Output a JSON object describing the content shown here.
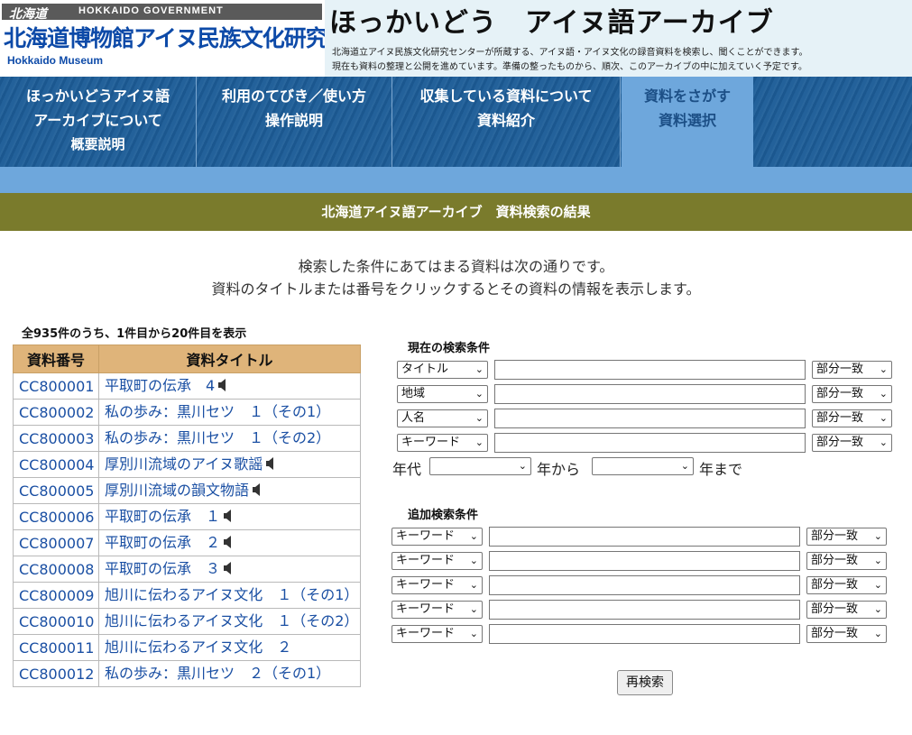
{
  "logo": {
    "script_text": "北海道",
    "gov_text": "HOKKAIDO GOVERNMENT",
    "name": "北海道博物館アイヌ民族文化研究センター",
    "english": "Hokkaido Museum"
  },
  "site": {
    "title": "ほっかいどう　アイヌ語アーカイブ",
    "desc_line1": "北海道立アイヌ民族文化研究センターが所蔵する、アイヌ語・アイヌ文化の録音資料を検索し、聞くことができます。",
    "desc_line2": "現在も資料の整理と公開を進めています。準備の整ったものから、順次、このアーカイブの中に加えていく予定です。"
  },
  "nav": [
    {
      "line1": "ほっかいどうアイヌ語",
      "line2": "アーカイブについて",
      "sub": "概要説明"
    },
    {
      "line1": "利用のてびき／使い方",
      "line2": "操作説明",
      "sub": ""
    },
    {
      "line1": "収集している資料について",
      "line2": "資料紹介",
      "sub": ""
    },
    {
      "line1": "資料をさがす",
      "line2": "資料選択",
      "sub": ""
    }
  ],
  "section_title": "北海道アイヌ語アーカイブ　資料検索の結果",
  "intro": {
    "line1": "検索した条件にあてはまる資料は次の通りです。",
    "line2": "資料のタイトルまたは番号をクリックするとその資料の情報を表示します。"
  },
  "results": {
    "count_text": "全935件のうち、1件目から20件目を表示",
    "headers": {
      "number": "資料番号",
      "title": "資料タイトル"
    },
    "rows": [
      {
        "id": "CC800001",
        "title": "平取町の伝承　4"
      },
      {
        "id": "CC800002",
        "title": "私の歩み：黒川セツ　１（その1）"
      },
      {
        "id": "CC800003",
        "title": "私の歩み：黒川セツ　１（その2）"
      },
      {
        "id": "CC800004",
        "title": "厚別川流域のアイヌ歌謡"
      },
      {
        "id": "CC800005",
        "title": "厚別川流域の韻文物語"
      },
      {
        "id": "CC800006",
        "title": "平取町の伝承　１"
      },
      {
        "id": "CC800007",
        "title": "平取町の伝承　２"
      },
      {
        "id": "CC800008",
        "title": "平取町の伝承　３"
      },
      {
        "id": "CC800009",
        "title": "旭川に伝わるアイヌ文化　１（その1）"
      },
      {
        "id": "CC800010",
        "title": "旭川に伝わるアイヌ文化　１（その2）"
      },
      {
        "id": "CC800011",
        "title": "旭川に伝わるアイヌ文化　２"
      },
      {
        "id": "CC800012",
        "title": "私の歩み：黒川セツ　２（その1）"
      }
    ]
  },
  "search": {
    "current_heading": "現在の検索条件",
    "fields": [
      {
        "field": "タイトル",
        "match": "部分一致"
      },
      {
        "field": "地域",
        "match": "部分一致"
      },
      {
        "field": "人名",
        "match": "部分一致"
      },
      {
        "field": "キーワード",
        "match": "部分一致"
      }
    ],
    "era_label": "年代",
    "from_label": "年から",
    "to_label": "年まで",
    "additional_heading": "追加検索条件",
    "additional_fields": [
      {
        "field": "キーワード",
        "match": "部分一致"
      },
      {
        "field": "キーワード",
        "match": "部分一致"
      },
      {
        "field": "キーワード",
        "match": "部分一致"
      },
      {
        "field": "キーワード",
        "match": "部分一致"
      },
      {
        "field": "キーワード",
        "match": "部分一致"
      }
    ],
    "button_label": "再検索"
  },
  "icons": {
    "audio": "speaker-icon",
    "dropdown": "chevron-down-icon"
  }
}
